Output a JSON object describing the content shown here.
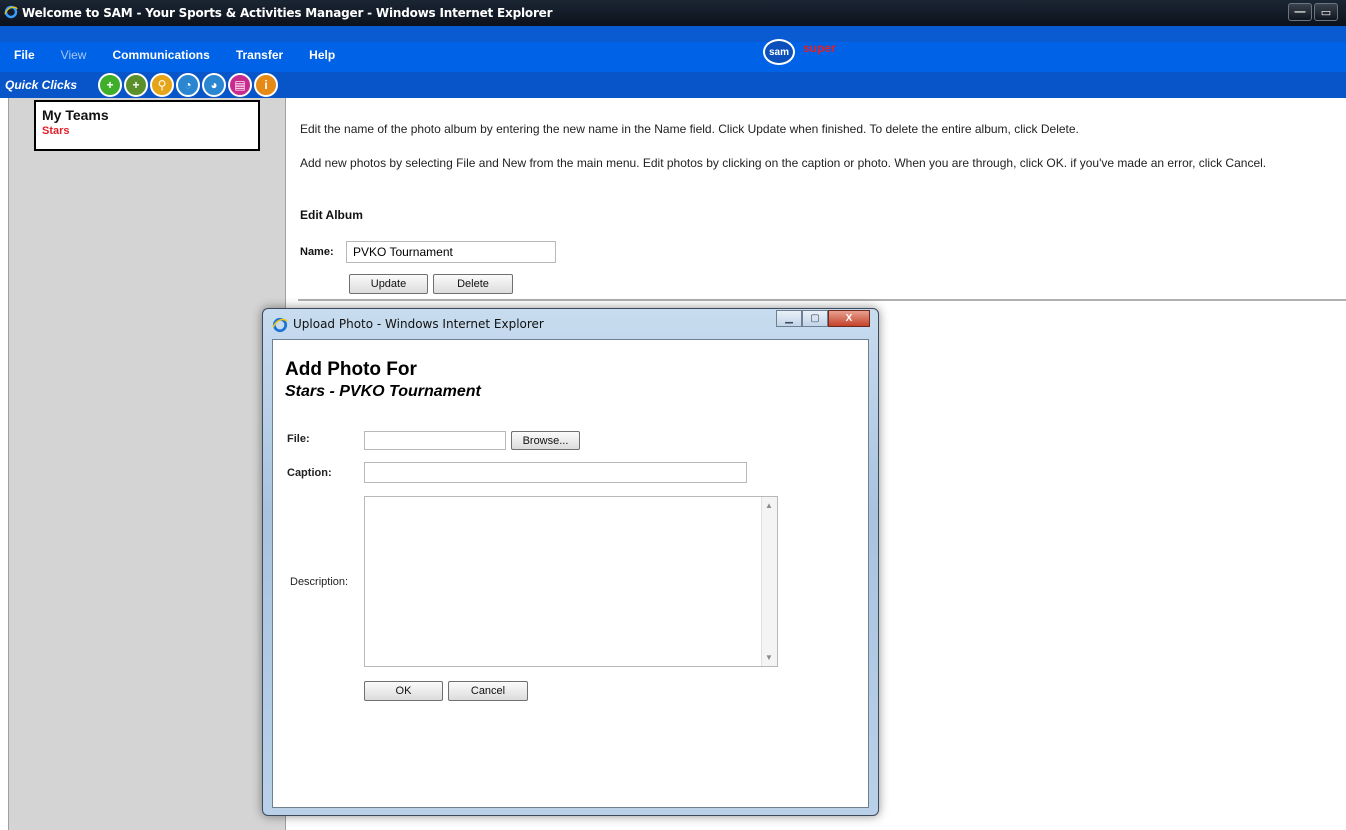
{
  "window": {
    "title": "Welcome to SAM - Your Sports & Activities Manager - Windows Internet Explorer",
    "minimize": "—",
    "restore": "▭"
  },
  "menu": {
    "file": "File",
    "view": "View",
    "communications": "Communications",
    "transfer": "Transfer",
    "help": "Help"
  },
  "brand": {
    "logo": "sam",
    "user": "super"
  },
  "quick_clicks": {
    "label": "Quick Clicks",
    "icons": [
      {
        "name": "add-team-icon",
        "glyph": "+",
        "color": "#3fae2a"
      },
      {
        "name": "add-member-icon",
        "glyph": "+",
        "color": "#5b8f2a"
      },
      {
        "name": "search-icon",
        "glyph": "⚲",
        "color": "#e6a417"
      },
      {
        "name": "activity-icon",
        "glyph": "◔",
        "color": "#2a86d1"
      },
      {
        "name": "schedule-icon",
        "glyph": "◕",
        "color": "#2a86d1"
      },
      {
        "name": "document-icon",
        "glyph": "▤",
        "color": "#c82a8e"
      },
      {
        "name": "info-icon",
        "glyph": "i",
        "color": "#e68a17"
      }
    ]
  },
  "sidebar": {
    "heading": "My Teams",
    "team": "Stars"
  },
  "main": {
    "para1": "Edit the name of the photo album by entering the new name in the Name field. Click Update when finished. To delete the entire album, click Delete.",
    "para2": "Add new photos by selecting File and New from the main menu. Edit photos by clicking on the caption or photo. When you are through, click OK. if you've made an error, click Cancel.",
    "edit_heading": "Edit Album",
    "name_label": "Name:",
    "name_value": "PVKO Tournament",
    "update_label": "Update",
    "delete_label": "Delete"
  },
  "popup": {
    "title": "Upload Photo - Windows Internet Explorer",
    "heading": "Add Photo For",
    "subheading": "Stars - PVKO Tournament",
    "file_label": "File:",
    "browse_label": "Browse...",
    "caption_label": "Caption:",
    "description_label": "Description:",
    "ok_label": "OK",
    "cancel_label": "Cancel",
    "close": "X"
  }
}
